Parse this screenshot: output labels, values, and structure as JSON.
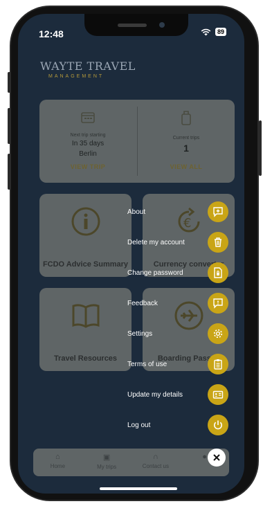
{
  "status_bar": {
    "time": "12:48",
    "battery": "89"
  },
  "logo": {
    "line1": "WAYTE TRAVEL",
    "line2": "MANAGEMENT"
  },
  "trip_summary": {
    "next": {
      "label": "Next trip starting",
      "days": "In 35 days",
      "city": "Berlin",
      "link": "VIEW TRIP"
    },
    "current": {
      "label": "Current trips",
      "count": "1",
      "link": "VIEW ALL"
    }
  },
  "tiles": [
    {
      "title": "FCDO Advice Summary",
      "icon": "info-icon"
    },
    {
      "title": "Currency converter",
      "icon": "currency-icon"
    },
    {
      "title": "Travel Resources",
      "icon": "book-icon"
    },
    {
      "title": "Boarding Passes",
      "icon": "plane-icon"
    }
  ],
  "bottom_nav": [
    {
      "label": "Home",
      "icon": "home-icon"
    },
    {
      "label": "My trips",
      "icon": "suitcase-icon"
    },
    {
      "label": "Contact us",
      "icon": "headset-icon"
    }
  ],
  "menu": [
    {
      "label": "About",
      "icon": "info-chat-icon"
    },
    {
      "label": "Delete my account",
      "icon": "trash-icon"
    },
    {
      "label": "Change password",
      "icon": "lock-file-icon"
    },
    {
      "label": "Feedback",
      "icon": "feedback-icon"
    },
    {
      "label": "Settings",
      "icon": "gear-icon"
    },
    {
      "label": "Terms of use",
      "icon": "clipboard-icon"
    },
    {
      "label": "Update my details",
      "icon": "id-card-icon"
    },
    {
      "label": "Log out",
      "icon": "power-icon"
    }
  ],
  "colors": {
    "accent": "#c9a516",
    "background": "#1c2b3c",
    "card": "#5f6566"
  }
}
